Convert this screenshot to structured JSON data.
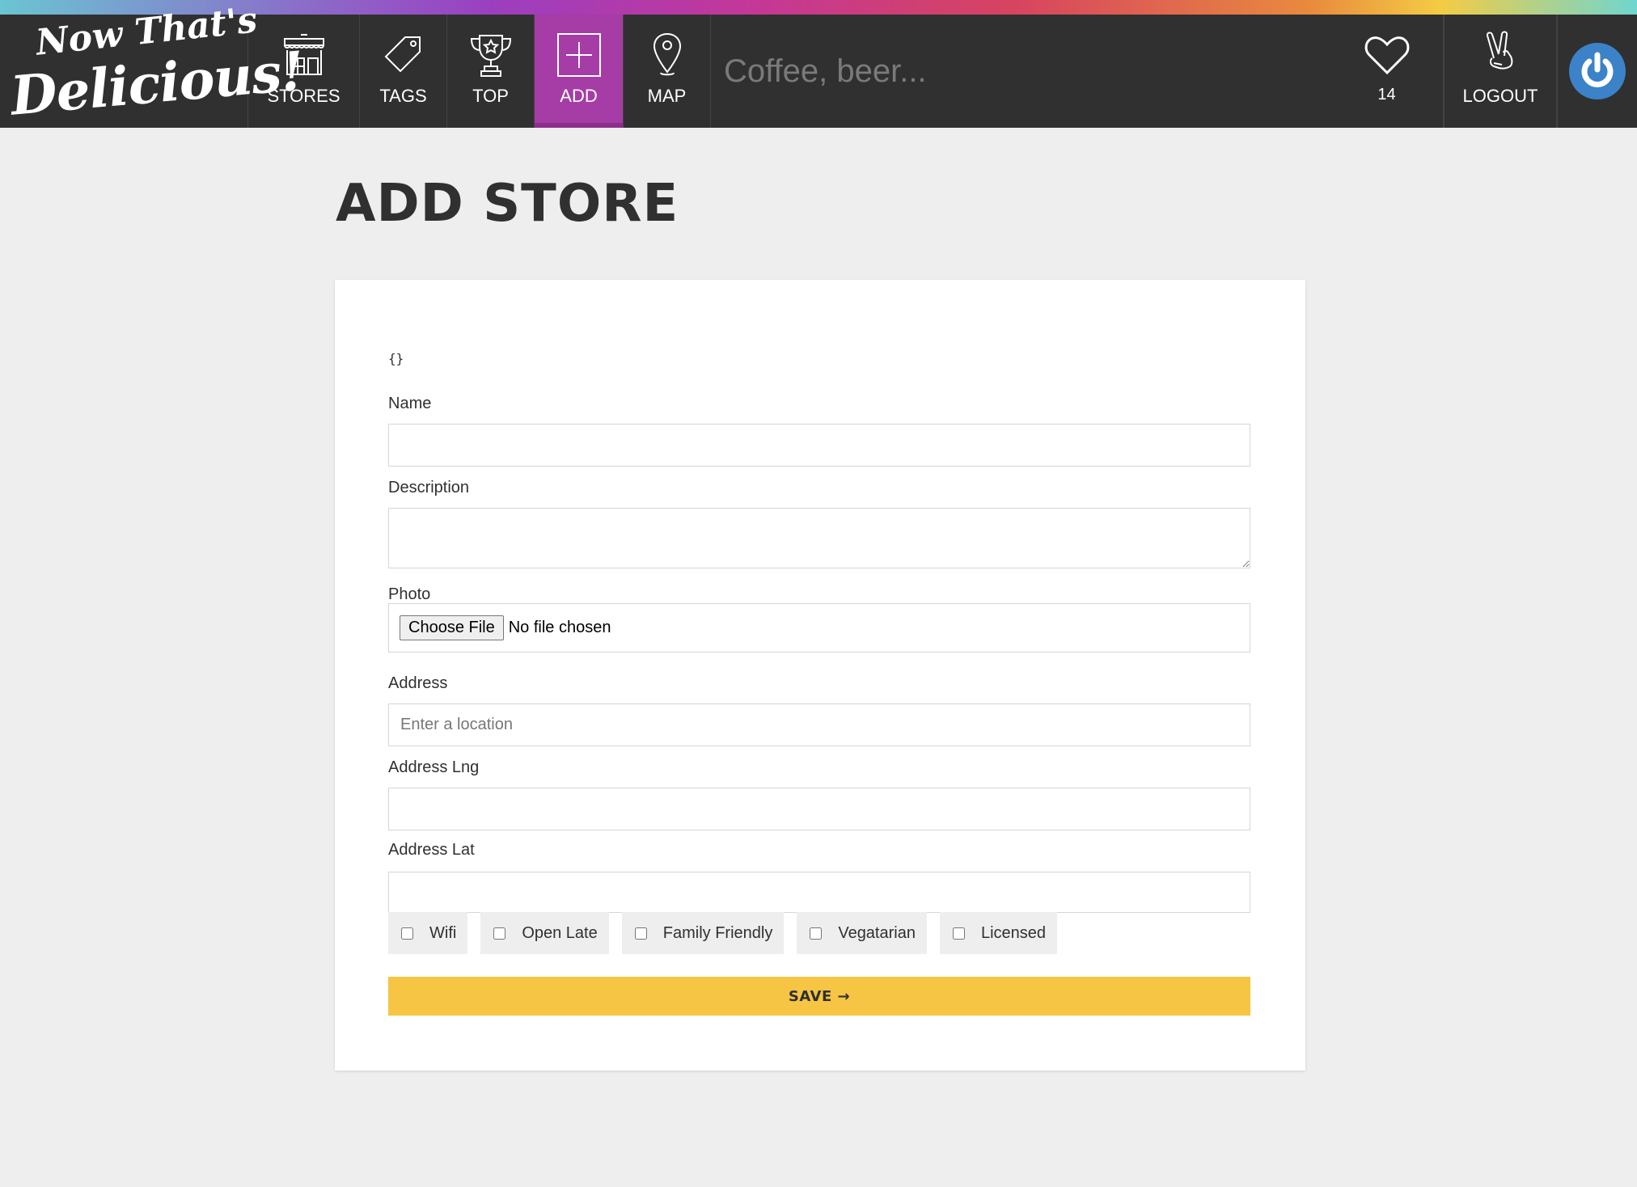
{
  "brand": {
    "line1": "Now That's",
    "line2": "Delicious!"
  },
  "nav": {
    "items": [
      {
        "label": "STORES",
        "icon": "store-icon"
      },
      {
        "label": "TAGS",
        "icon": "tag-icon"
      },
      {
        "label": "TOP",
        "icon": "trophy-icon"
      },
      {
        "label": "ADD",
        "icon": "add-icon",
        "active": true
      },
      {
        "label": "MAP",
        "icon": "map-pin-icon"
      }
    ],
    "search_placeholder": "Coffee, beer...",
    "hearts": {
      "icon": "heart-icon",
      "count": "14"
    },
    "logout": {
      "label": "LOGOUT",
      "icon": "peace-hand-icon"
    },
    "avatar_icon": "power-icon",
    "active_color": "#a63ca6"
  },
  "page": {
    "title": "ADD STORE"
  },
  "form": {
    "debug": "{}",
    "name_label": "Name",
    "name_value": "",
    "description_label": "Description",
    "description_value": "",
    "photo_label": "Photo",
    "photo_button": "Choose File",
    "photo_status": "No file chosen",
    "address_label": "Address",
    "address_placeholder": "Enter a location",
    "lng_label": "Address Lng",
    "lat_label": "Address Lat",
    "tags": [
      {
        "label": "Wifi",
        "checked": false
      },
      {
        "label": "Open Late",
        "checked": false
      },
      {
        "label": "Family Friendly",
        "checked": false
      },
      {
        "label": "Vegatarian",
        "checked": false
      },
      {
        "label": "Licensed",
        "checked": false
      }
    ],
    "save_label": "SAVE →",
    "save_color": "#f6c543"
  }
}
